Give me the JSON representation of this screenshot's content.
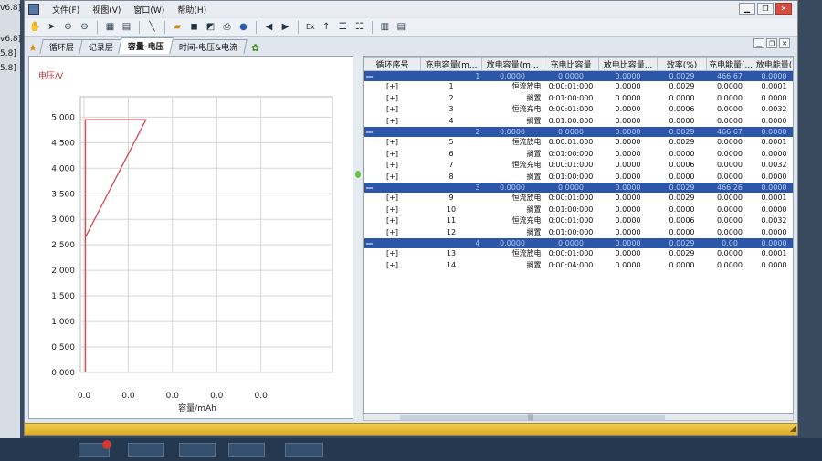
{
  "left_fragments": [
    "v6.8]",
    "v6.8]",
    "5.8]",
    "5.8]"
  ],
  "menu": [
    "文件(F)",
    "视图(V)",
    "窗口(W)",
    "帮助(H)"
  ],
  "toolbar": {
    "text_button": "Ex"
  },
  "tabs": [
    "循环层",
    "记录层",
    "容量-电压",
    "时间-电压&电流"
  ],
  "active_tab": 2,
  "chart_data": {
    "type": "line",
    "ylabel": "电压/V",
    "xlabel": "容量/mAh",
    "y_ticks": [
      "5.000",
      "4.500",
      "4.000",
      "3.500",
      "3.000",
      "2.500",
      "2.000",
      "1.500",
      "1.000",
      "0.500",
      "0.000"
    ],
    "x_ticks": [
      "0.0",
      "0.0",
      "0.0",
      "0.0",
      "0.0"
    ],
    "ylim": [
      0,
      5.4
    ],
    "xlim": [
      0,
      1
    ],
    "grid": true,
    "series": [
      {
        "color": "#d0484f",
        "points": [
          [
            0.02,
            0.0
          ],
          [
            0.02,
            4.95
          ],
          [
            0.26,
            4.95
          ],
          [
            0.02,
            2.65
          ]
        ]
      }
    ]
  },
  "grid": {
    "headers": [
      "循环序号",
      "充电容量(m...",
      "放电容量(m...",
      "充电比容量",
      "放电比容量...",
      "效率(%)",
      "充电能量(...",
      "放电能量("
    ],
    "cycles": [
      {
        "toggle": "—",
        "no": "1",
        "c1": "0.0000",
        "c2": "0.0000",
        "c3": "0.0000",
        "c4": "0.0029",
        "c5": "466.67",
        "c6": "0.0000",
        "c7": "0.0000",
        "steps": [
          {
            "expand": "[+]",
            "no": "1",
            "name": "恒流放电",
            "time": "0:00:01:000",
            "v1": "0.0000",
            "v2": "0.0029",
            "v3": "0.0000",
            "v4": "0.0001"
          },
          {
            "expand": "[+]",
            "no": "2",
            "name": "搁置",
            "time": "0:01:00:000",
            "v1": "0.0000",
            "v2": "0.0000",
            "v3": "0.0000",
            "v4": "0.0000"
          },
          {
            "expand": "[+]",
            "no": "3",
            "name": "恒流充电",
            "time": "0:00:01:000",
            "v1": "0.0000",
            "v2": "0.0006",
            "v3": "0.0000",
            "v4": "0.0032"
          },
          {
            "expand": "[+]",
            "no": "4",
            "name": "搁置",
            "time": "0:01:00:000",
            "v1": "0.0000",
            "v2": "0.0000",
            "v3": "0.0000",
            "v4": "0.0000"
          }
        ]
      },
      {
        "toggle": "—",
        "no": "2",
        "c1": "0.0000",
        "c2": "0.0000",
        "c3": "0.0000",
        "c4": "0.0029",
        "c5": "466.67",
        "c6": "0.0000",
        "c7": "0.0000",
        "steps": [
          {
            "expand": "[+]",
            "no": "5",
            "name": "恒流放电",
            "time": "0:00:01:000",
            "v1": "0.0000",
            "v2": "0.0029",
            "v3": "0.0000",
            "v4": "0.0001"
          },
          {
            "expand": "[+]",
            "no": "6",
            "name": "搁置",
            "time": "0:01:00:000",
            "v1": "0.0000",
            "v2": "0.0000",
            "v3": "0.0000",
            "v4": "0.0000"
          },
          {
            "expand": "[+]",
            "no": "7",
            "name": "恒流充电",
            "time": "0:00:01:000",
            "v1": "0.0000",
            "v2": "0.0006",
            "v3": "0.0000",
            "v4": "0.0032"
          },
          {
            "expand": "[+]",
            "no": "8",
            "name": "搁置",
            "time": "0:01:00:000",
            "v1": "0.0000",
            "v2": "0.0000",
            "v3": "0.0000",
            "v4": "0.0000"
          }
        ]
      },
      {
        "toggle": "—",
        "no": "3",
        "c1": "0.0000",
        "c2": "0.0000",
        "c3": "0.0000",
        "c4": "0.0029",
        "c5": "466.26",
        "c6": "0.0000",
        "c7": "0.0000",
        "steps": [
          {
            "expand": "[+]",
            "no": "9",
            "name": "恒流放电",
            "time": "0:00:01:000",
            "v1": "0.0000",
            "v2": "0.0029",
            "v3": "0.0000",
            "v4": "0.0001"
          },
          {
            "expand": "[+]",
            "no": "10",
            "name": "搁置",
            "time": "0:01:00:000",
            "v1": "0.0000",
            "v2": "0.0000",
            "v3": "0.0000",
            "v4": "0.0000"
          },
          {
            "expand": "[+]",
            "no": "11",
            "name": "恒流充电",
            "time": "0:00:01:000",
            "v1": "0.0000",
            "v2": "0.0006",
            "v3": "0.0000",
            "v4": "0.0032"
          },
          {
            "expand": "[+]",
            "no": "12",
            "name": "搁置",
            "time": "0:01:00:000",
            "v1": "0.0000",
            "v2": "0.0000",
            "v3": "0.0000",
            "v4": "0.0000"
          }
        ]
      },
      {
        "toggle": "—",
        "no": "4",
        "c1": "0.0000",
        "c2": "0.0000",
        "c3": "0.0000",
        "c4": "0.0029",
        "c5": "0.00",
        "c6": "0.0000",
        "c7": "0.0000",
        "steps": [
          {
            "expand": "[+]",
            "no": "13",
            "name": "恒流放电",
            "time": "0:00:01:000",
            "v1": "0.0000",
            "v2": "0.0029",
            "v3": "0.0000",
            "v4": "0.0001"
          },
          {
            "expand": "[+]",
            "no": "14",
            "name": "搁置",
            "time": "0:00:04:000",
            "v1": "0.0000",
            "v2": "0.0000",
            "v3": "0.0000",
            "v4": "0.0000"
          }
        ]
      }
    ]
  }
}
